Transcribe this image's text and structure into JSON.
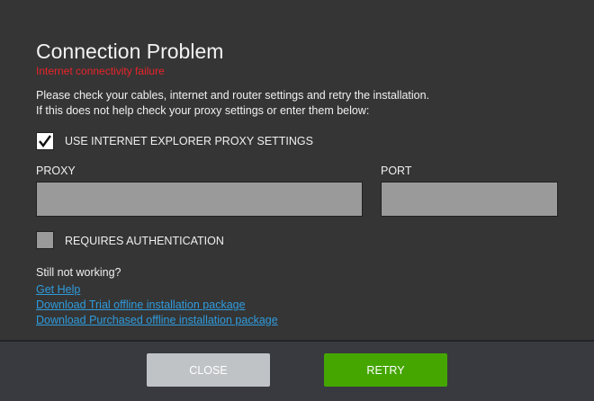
{
  "dialog": {
    "title": "Connection Problem",
    "subtitle": "Internet connectivity failure",
    "message_line1": "Please check your cables, internet and router settings and retry the installation.",
    "message_line2": "If this does not help check your proxy settings or enter them below:",
    "use_ie_proxy": {
      "label": "USE INTERNET EXPLORER PROXY SETTINGS",
      "checked": true
    },
    "proxy": {
      "label": "PROXY",
      "value": ""
    },
    "port": {
      "label": "PORT",
      "value": ""
    },
    "requires_auth": {
      "label": "REQUIRES AUTHENTICATION",
      "checked": false
    },
    "help": {
      "heading": "Still not working?",
      "links": [
        "Get Help",
        "Download Trial offline installation package",
        "Download Purchased offline installation package"
      ]
    }
  },
  "footer": {
    "close_label": "CLOSE",
    "retry_label": "RETRY"
  },
  "colors": {
    "error": "#e8242a",
    "link": "#2f9bdc",
    "retry": "#45a600"
  }
}
